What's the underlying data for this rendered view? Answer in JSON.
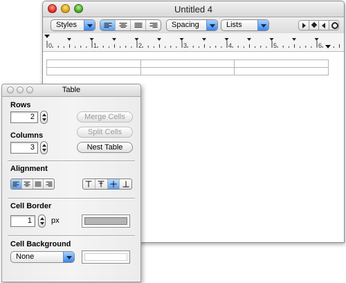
{
  "document": {
    "title": "Untitled 4",
    "toolbar": {
      "styles_label": "Styles",
      "spacing_label": "Spacing",
      "lists_label": "Lists",
      "alignment": [
        "left",
        "center",
        "justify",
        "right"
      ],
      "alignment_selected": "left",
      "nav_icons": [
        "next-triangle-icon",
        "diamond-icon",
        "previous-triangle-icon",
        "ring-icon"
      ]
    },
    "ruler": {
      "numbers": [
        "0",
        "1",
        "2",
        "3",
        "4",
        "5",
        "6"
      ]
    },
    "table": {
      "rows": 2,
      "columns": 3
    }
  },
  "panel": {
    "title": "Table",
    "rows": {
      "label": "Rows",
      "value": "2"
    },
    "columns": {
      "label": "Columns",
      "value": "3"
    },
    "buttons": {
      "merge": "Merge Cells",
      "split": "Split Cells",
      "nest": "Nest Table"
    },
    "alignment": {
      "label": "Alignment",
      "horizontal": [
        "left",
        "center",
        "justify",
        "right"
      ],
      "horizontal_selected": "left",
      "vertical": [
        "top",
        "middle",
        "center",
        "bottom"
      ],
      "vertical_selected": "center"
    },
    "border": {
      "label": "Cell Border",
      "value": "1",
      "unit": "px",
      "color": "#b4b4b4"
    },
    "background": {
      "label": "Cell Background",
      "value": "None",
      "color": "#ffffff"
    }
  },
  "colors": {
    "accent": "#5b9ef0"
  }
}
